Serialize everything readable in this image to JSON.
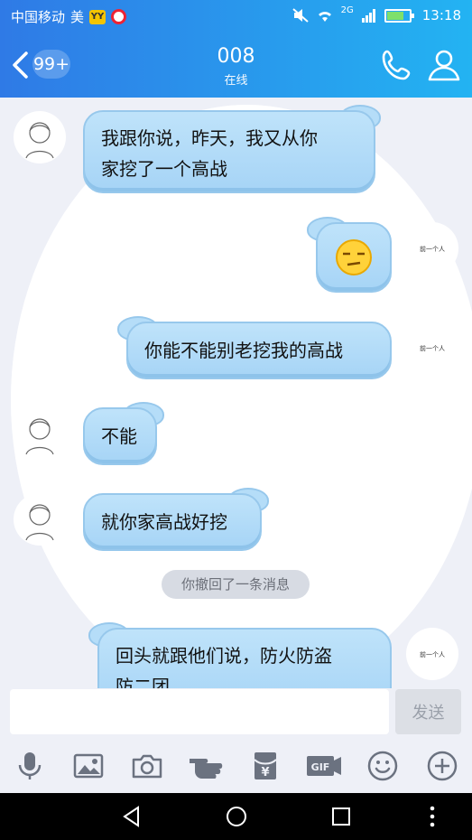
{
  "status_bar": {
    "carrier": "中国移动",
    "app_char": "美",
    "network": "2G",
    "time": "13:18"
  },
  "header": {
    "unread_count": "99+",
    "title": "008",
    "subtitle": "在线",
    "accent": "#2f7ae6"
  },
  "messages": [
    {
      "side": "left",
      "text": "我跟你说，昨天，我又从你\n家挖了一个高战"
    },
    {
      "side": "right",
      "text": "",
      "emoji": "smirk-emoji"
    },
    {
      "side": "right",
      "text": "你能不能别老挖我的高战"
    },
    {
      "side": "left",
      "text": "不能"
    },
    {
      "side": "left",
      "text": "就你家高战好挖"
    },
    {
      "side": "right",
      "text": "回头就跟他们说，防火防盗\n防二团"
    }
  ],
  "recall_notice": "你撤回了一条消息",
  "right_avatar_text": "前一个人",
  "input": {
    "placeholder": "",
    "value": "",
    "send_label": "发送"
  },
  "toolbar_icons": [
    "microphone-icon",
    "image-icon",
    "camera-icon",
    "poke-icon",
    "red-packet-icon",
    "gif-icon",
    "emoji-icon",
    "plus-icon"
  ],
  "gif_label": "GIF",
  "yuan_symbol": "¥"
}
